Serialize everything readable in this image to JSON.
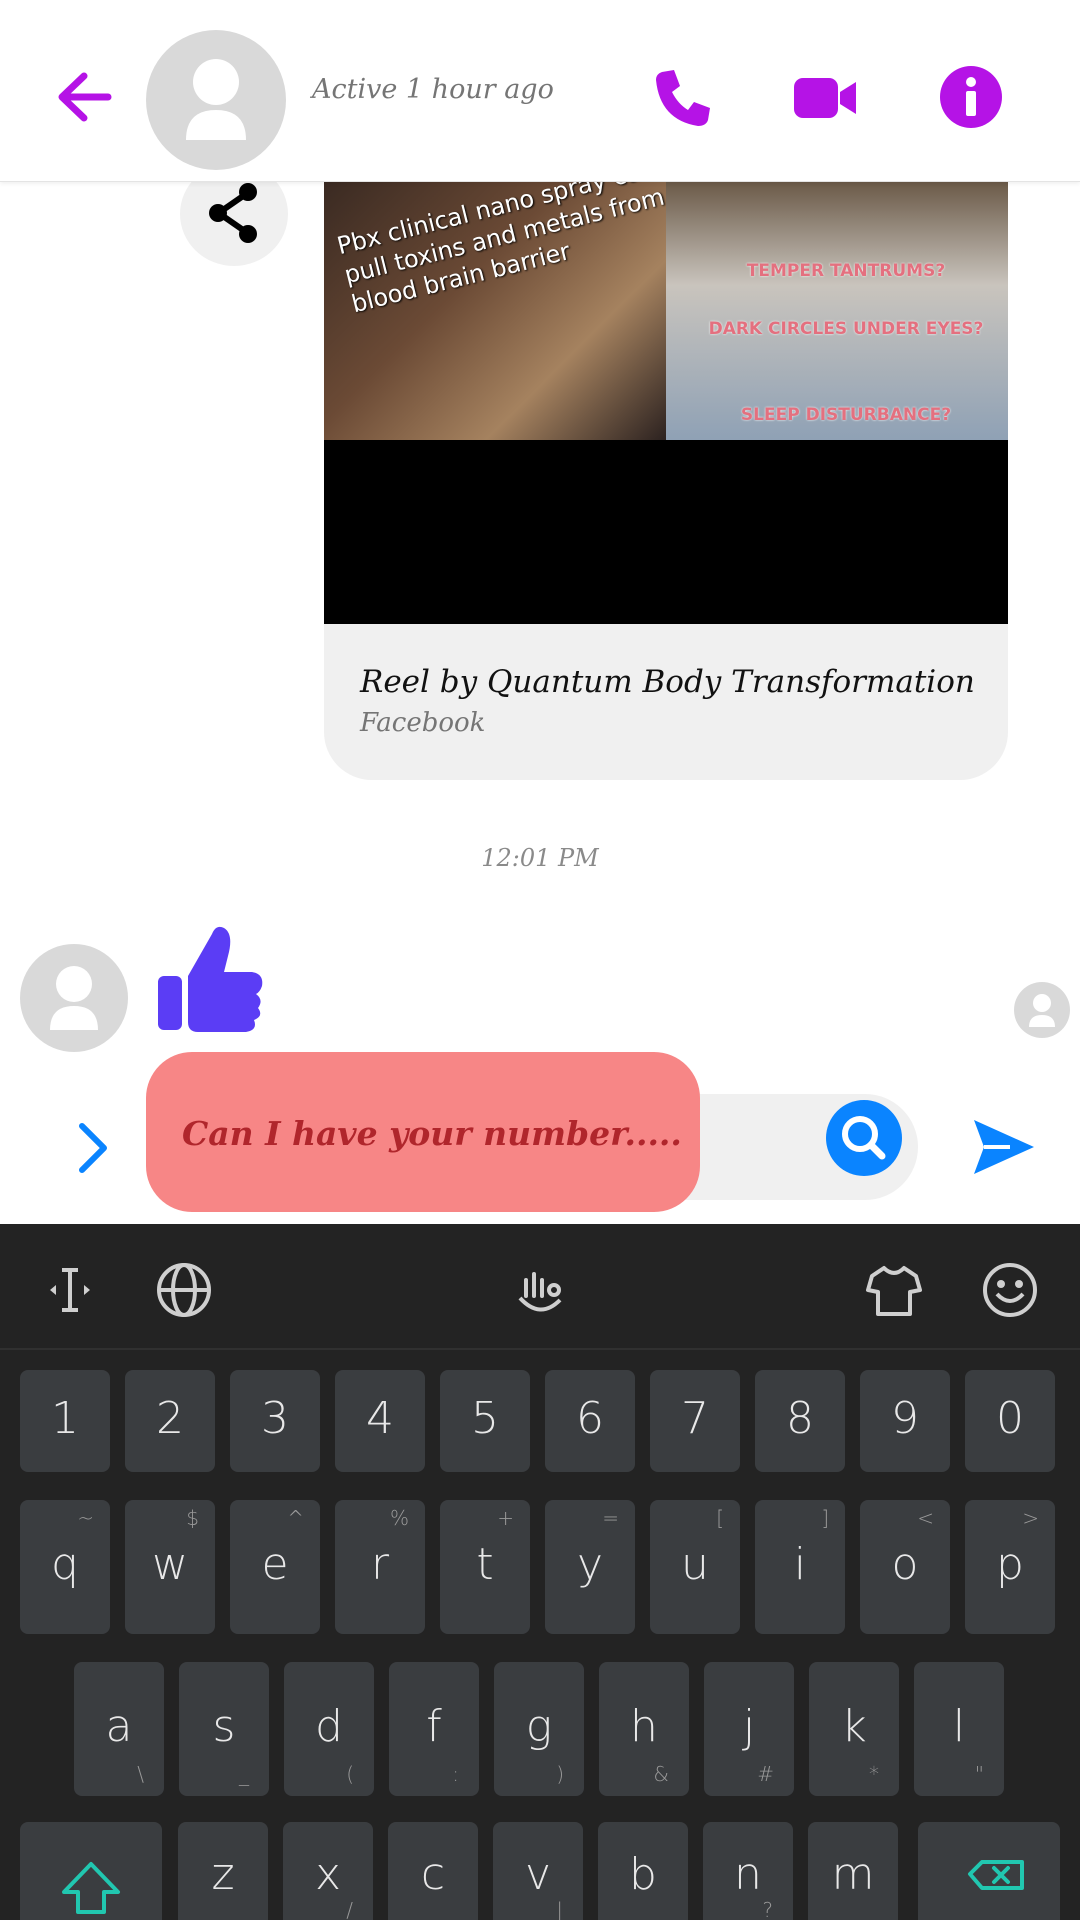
{
  "header": {
    "status": "Active 1 hour ago"
  },
  "reel": {
    "overlay_left": "Pbx clinical nano spray can pull toxins and metals from blood brain barrier",
    "overlay_right_1": "TEMPER TANTRUMS?",
    "overlay_right_2": "DARK CIRCLES UNDER EYES?",
    "overlay_right_3": "SLEEP DISTURBANCE?",
    "title": "Reel by Quantum Body Transformation",
    "source": "Facebook"
  },
  "thread": {
    "timestamp": "12:01 PM"
  },
  "composer": {
    "message": "Can I have your number....."
  },
  "keyboard": {
    "number_row": [
      "1",
      "2",
      "3",
      "4",
      "5",
      "6",
      "7",
      "8",
      "9",
      "0"
    ],
    "row1": [
      {
        "k": "q",
        "h": "~"
      },
      {
        "k": "w",
        "h": "$"
      },
      {
        "k": "e",
        "h": "^"
      },
      {
        "k": "r",
        "h": "%"
      },
      {
        "k": "t",
        "h": "+"
      },
      {
        "k": "y",
        "h": "="
      },
      {
        "k": "u",
        "h": "["
      },
      {
        "k": "i",
        "h": "]"
      },
      {
        "k": "o",
        "h": "<"
      },
      {
        "k": "p",
        "h": ">"
      }
    ],
    "row2": [
      {
        "k": "a",
        "h": "\\"
      },
      {
        "k": "s",
        "h": "_"
      },
      {
        "k": "d",
        "h": "("
      },
      {
        "k": "f",
        "h": ":"
      },
      {
        "k": "g",
        "h": ")"
      },
      {
        "k": "h",
        "h": "&"
      },
      {
        "k": "j",
        "h": "#"
      },
      {
        "k": "k",
        "h": "*"
      },
      {
        "k": "l",
        "h": "\""
      }
    ],
    "row3": [
      {
        "k": "z",
        "h": ""
      },
      {
        "k": "x",
        "h": "/"
      },
      {
        "k": "c",
        "h": ""
      },
      {
        "k": "v",
        "h": "|"
      },
      {
        "k": "b",
        "h": ""
      },
      {
        "k": "n",
        "h": "?"
      },
      {
        "k": "m",
        "h": ""
      }
    ]
  },
  "colors": {
    "accent": "#b513e6",
    "like": "#5b3df5",
    "send": "#0a84ff",
    "bubble": "#f78686"
  }
}
